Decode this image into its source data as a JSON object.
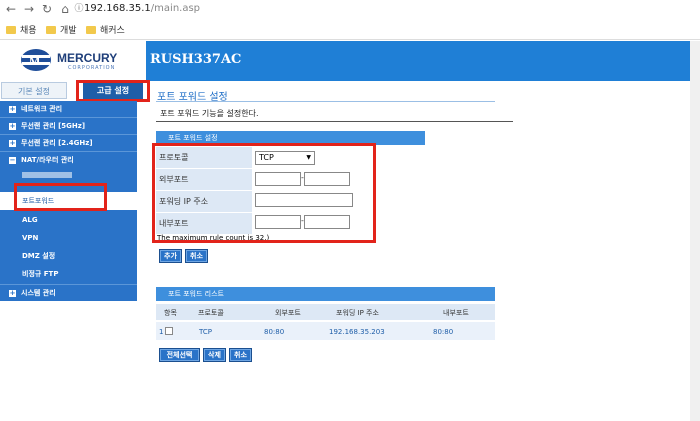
{
  "browser": {
    "url_host": "192.168.35.1",
    "url_path": "/main.asp",
    "bookmarks": [
      "채용",
      "개발",
      "해커스"
    ]
  },
  "header": {
    "logo_text": "MERCURY",
    "logo_sub": "CORPORATION",
    "product_name": "RUSH337AC"
  },
  "sidebar": {
    "tabs": [
      "기본 설정",
      "고급 설정"
    ],
    "menu": [
      "네트워크 관리",
      "무선랜 관리 [5GHz]",
      "무선랜 관리 [2.4GHz]",
      "NAT/라우터 관리"
    ],
    "sub": [
      "포트포워드",
      "ALG",
      "VPN",
      "DMZ 설정",
      "비정규 FTP"
    ],
    "menu_bottom": "시스템 관리"
  },
  "main": {
    "title": "포트 포워드 설정",
    "description": "포트 포워드 기능을 설정한다.",
    "form": {
      "section": "포트 포워드 설정",
      "labels": [
        "프로토콜",
        "외부포트",
        "포워딩 IP 주소",
        "내부포트"
      ],
      "protocol_value": "TCP",
      "note": "The maximum rule count is 32.)"
    },
    "buttons_form": [
      "추가",
      "취소"
    ],
    "list": {
      "section": "포트 포워드 리스트",
      "headers": [
        "항목",
        "프로토콜",
        "외부포트",
        "포워딩 IP 주소",
        "내부포트"
      ],
      "rows": [
        {
          "index": "1",
          "protocol": "TCP",
          "ext_port": "80:80",
          "ip": "192.168.35.203",
          "int_port": "80:80"
        }
      ]
    },
    "buttons_list": [
      "전체선택",
      "삭제",
      "취소"
    ]
  },
  "colors": {
    "accent_blue": "#2a73c8",
    "highlight_red": "#e2231a"
  }
}
